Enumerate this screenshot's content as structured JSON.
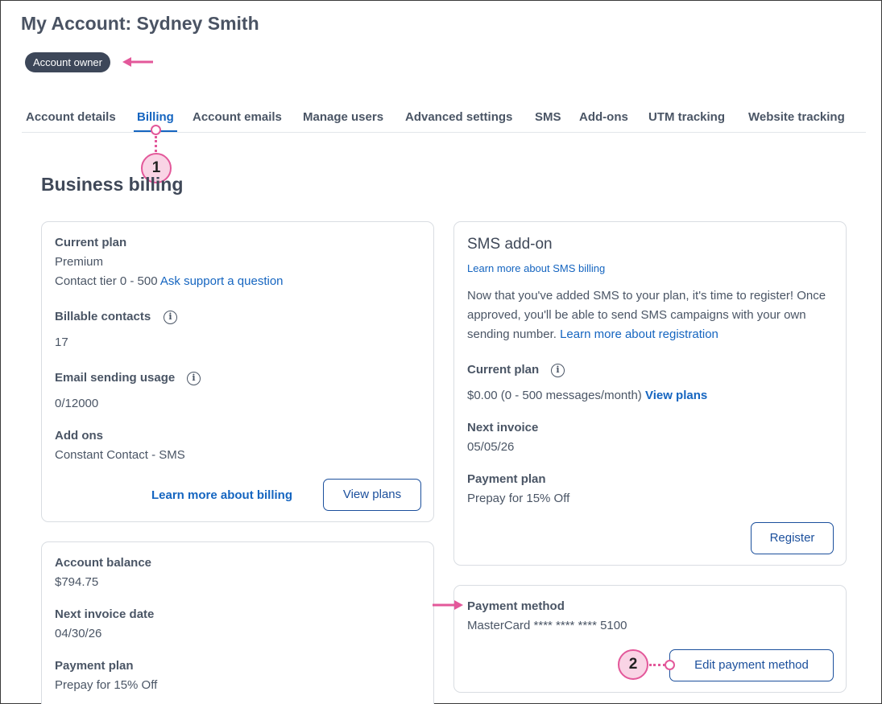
{
  "header": {
    "title": "My Account: Sydney Smith",
    "badge": "Account owner"
  },
  "tabs": [
    {
      "label": "Account details",
      "active": false
    },
    {
      "label": "Billing",
      "active": true
    },
    {
      "label": "Account emails",
      "active": false
    },
    {
      "label": "Manage users",
      "active": false
    },
    {
      "label": "Advanced settings",
      "active": false
    },
    {
      "label": "SMS",
      "active": false
    },
    {
      "label": "Add-ons",
      "active": false
    },
    {
      "label": "UTM tracking",
      "active": false
    },
    {
      "label": "Website tracking",
      "active": false
    }
  ],
  "section_title": "Business billing",
  "plan_card": {
    "current_plan_label": "Current plan",
    "current_plan_value": "Premium",
    "contact_tier": "Contact tier 0 - 500",
    "support_link": "Ask support a question",
    "billable_contacts_label": "Billable contacts",
    "billable_contacts_value": "17",
    "email_usage_label": "Email sending usage",
    "email_usage_value": "0/12000",
    "addons_label": "Add ons",
    "addons_value": "Constant Contact - SMS",
    "billing_link": "Learn more about billing",
    "view_plans_button": "View plans"
  },
  "balance_card": {
    "balance_label": "Account balance",
    "balance_value": "$794.75",
    "next_invoice_label": "Next invoice date",
    "next_invoice_value": "04/30/26",
    "payment_plan_label": "Payment plan",
    "payment_plan_value": "Prepay for 15% Off"
  },
  "sms_card": {
    "title": "SMS add-on",
    "billing_link": "Learn more about SMS billing",
    "description": "Now that you've added SMS to your plan, it's time to register! Once approved, you'll be able to send SMS campaigns with your own sending number.",
    "registration_link": "Learn more about registration",
    "current_plan_label": "Current plan",
    "current_plan_value": "$0.00 (0 - 500 messages/month)",
    "view_plans_link": "View plans",
    "next_invoice_label": "Next invoice",
    "next_invoice_value": "05/05/26",
    "payment_plan_label": "Payment plan",
    "payment_plan_value": "Prepay for 15% Off",
    "register_button": "Register"
  },
  "payment_card": {
    "label": "Payment method",
    "value": "MasterCard **** **** **** 5100",
    "edit_button": "Edit payment method"
  },
  "callouts": {
    "one": "1",
    "two": "2"
  },
  "colors": {
    "accent": "#1565c0",
    "callout": "#e3589a",
    "badge_bg": "#3d4759"
  },
  "icons": {
    "info": "info-circle-icon",
    "arrow": "pointer-arrow-icon"
  }
}
